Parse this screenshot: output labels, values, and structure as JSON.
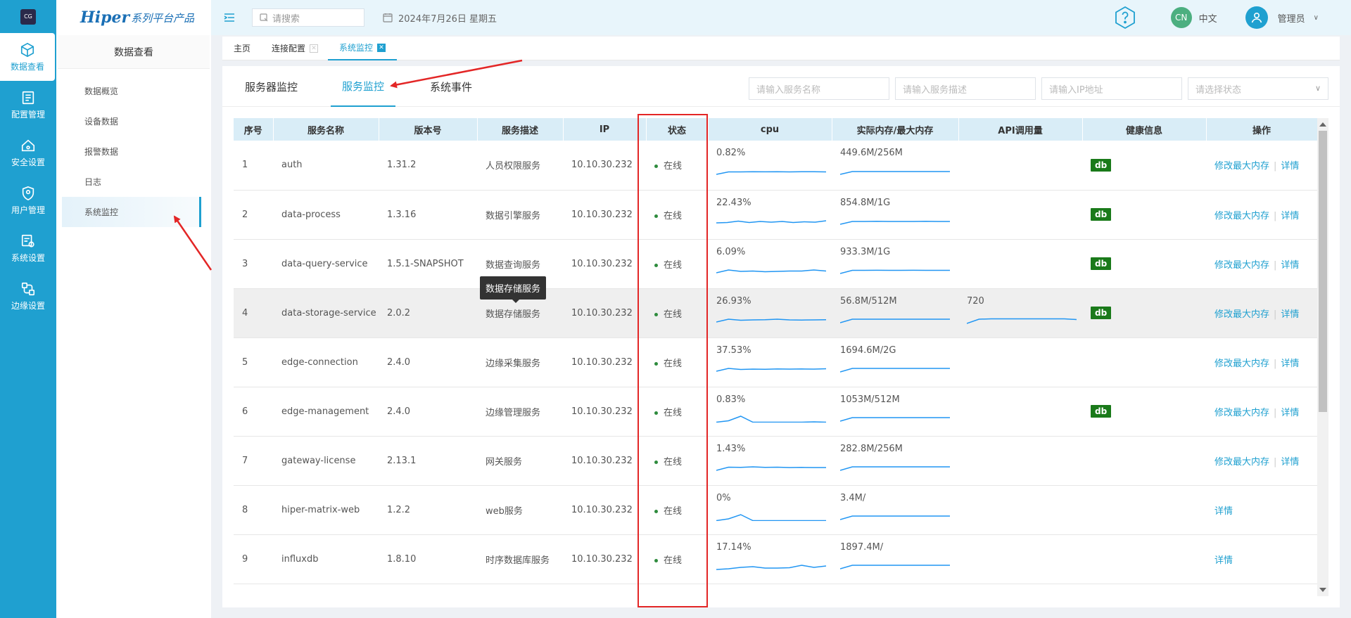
{
  "rail": {
    "logo_text": "CG",
    "items": [
      {
        "label": "数据查看",
        "icon": "cube-icon",
        "active": true
      },
      {
        "label": "配置管理",
        "icon": "config-icon",
        "active": false
      },
      {
        "label": "安全设置",
        "icon": "security-icon",
        "active": false
      },
      {
        "label": "用户管理",
        "icon": "user-shield-icon",
        "active": false
      },
      {
        "label": "系统设置",
        "icon": "system-settings-icon",
        "active": false
      },
      {
        "label": "边缘设置",
        "icon": "edge-icon",
        "active": false
      }
    ]
  },
  "brand": {
    "main": "Hiper",
    "sub": "系列平台产品"
  },
  "sidebar": {
    "title": "数据查看",
    "items": [
      {
        "label": "数据概览",
        "active": false
      },
      {
        "label": "设备数据",
        "active": false
      },
      {
        "label": "报警数据",
        "active": false
      },
      {
        "label": "日志",
        "active": false
      },
      {
        "label": "系统监控",
        "active": true
      }
    ]
  },
  "topbar": {
    "search_placeholder": "请搜索",
    "date": "2024年7月26日 星期五",
    "lang_avatar": "CN",
    "lang_label": "中文",
    "user_label": "管理员"
  },
  "page_tabs": [
    {
      "label": "主页",
      "closable": false,
      "active": false
    },
    {
      "label": "连接配置",
      "closable": true,
      "active": false
    },
    {
      "label": "系统监控",
      "closable": true,
      "active": true
    }
  ],
  "sub_tabs": [
    {
      "label": "服务器监控",
      "active": false
    },
    {
      "label": "服务监控",
      "active": true
    },
    {
      "label": "系统事件",
      "active": false
    }
  ],
  "filters": {
    "service_name": "请输入服务名称",
    "service_desc": "请输入服务描述",
    "ip": "请输入IP地址",
    "status": "请选择状态"
  },
  "table": {
    "headers": [
      "序号",
      "服务名称",
      "版本号",
      "服务描述",
      "IP",
      "状态",
      "cpu",
      "实际内存/最大内存",
      "API调用量",
      "健康信息",
      "操作"
    ],
    "rows": [
      {
        "idx": "1",
        "name": "auth",
        "version": "1.31.2",
        "desc": "人员权限服务",
        "ip": "10.10.30.232",
        "status": "在线",
        "cpu": "0.82%",
        "mem": "449.6M/256M",
        "api": "",
        "health": "db",
        "ops": [
          "修改最大内存",
          "详情"
        ],
        "cpu_series": [
          0.2,
          0.55,
          0.55,
          0.58,
          0.56,
          0.58,
          0.55,
          0.58,
          0.57,
          0.55
        ],
        "mem_series": [
          0.2,
          0.6,
          0.6,
          0.6,
          0.6,
          0.6,
          0.6,
          0.6,
          0.6,
          0.6
        ],
        "api_series": []
      },
      {
        "idx": "2",
        "name": "data-process",
        "version": "1.3.16",
        "desc": "数据引擎服务",
        "ip": "10.10.30.232",
        "status": "在线",
        "cpu": "22.43%",
        "mem": "854.8M/1G",
        "api": "",
        "health": "db",
        "ops": [
          "修改最大内存",
          "详情"
        ],
        "cpu_series": [
          0.4,
          0.45,
          0.65,
          0.45,
          0.6,
          0.5,
          0.6,
          0.45,
          0.55,
          0.5,
          0.7
        ],
        "mem_series": [
          0.2,
          0.6,
          0.6,
          0.62,
          0.6,
          0.6,
          0.6,
          0.62,
          0.6,
          0.6
        ],
        "api_series": []
      },
      {
        "idx": "3",
        "name": "data-query-service",
        "version": "1.5.1-SNAPSHOT",
        "desc": "数据查询服务",
        "ip": "10.10.30.232",
        "status": "在线",
        "cpu": "6.09%",
        "mem": "933.3M/1G",
        "api": "",
        "health": "db",
        "ops": [
          "修改最大内存",
          "详情"
        ],
        "cpu_series": [
          0.3,
          0.7,
          0.5,
          0.55,
          0.45,
          0.5,
          0.55,
          0.55,
          0.7,
          0.55
        ],
        "mem_series": [
          0.2,
          0.65,
          0.65,
          0.66,
          0.65,
          0.65,
          0.66,
          0.65,
          0.65,
          0.65
        ],
        "api_series": []
      },
      {
        "idx": "4",
        "name": "data-storage-service",
        "version": "2.0.2",
        "desc": "数据存储服务",
        "ip": "10.10.30.232",
        "status": "在线",
        "cpu": "26.93%",
        "mem": "56.8M/512M",
        "api": "720",
        "health": "db",
        "ops": [
          "修改最大内存",
          "详情"
        ],
        "cpu_series": [
          0.3,
          0.7,
          0.55,
          0.6,
          0.62,
          0.7,
          0.6,
          0.58,
          0.6,
          0.62
        ],
        "mem_series": [
          0.2,
          0.7,
          0.7,
          0.7,
          0.7,
          0.7,
          0.7,
          0.7,
          0.7,
          0.7
        ],
        "api_series": [
          0.1,
          0.7,
          0.75,
          0.75,
          0.75,
          0.75,
          0.75,
          0.75,
          0.75,
          0.65
        ],
        "hover": true
      },
      {
        "idx": "5",
        "name": "edge-connection",
        "version": "2.4.0",
        "desc": "边缘采集服务",
        "ip": "10.10.30.232",
        "status": "在线",
        "cpu": "37.53%",
        "mem": "1694.6M/2G",
        "api": "",
        "health": "",
        "ops": [
          "修改最大内存",
          "详情"
        ],
        "cpu_series": [
          0.3,
          0.7,
          0.55,
          0.6,
          0.58,
          0.62,
          0.6,
          0.62,
          0.6,
          0.65
        ],
        "mem_series": [
          0.2,
          0.7,
          0.7,
          0.7,
          0.7,
          0.7,
          0.7,
          0.7,
          0.7,
          0.7
        ],
        "api_series": []
      },
      {
        "idx": "6",
        "name": "edge-management",
        "version": "2.4.0",
        "desc": "边缘管理服务",
        "ip": "10.10.30.232",
        "status": "在线",
        "cpu": "0.83%",
        "mem": "1053M/512M",
        "api": "",
        "health": "db",
        "ops": [
          "修改最大内存",
          "详情"
        ],
        "cpu_series": [
          0.05,
          0.25,
          0.9,
          0.05,
          0.05,
          0.05,
          0.05,
          0.05,
          0.1,
          0.05
        ],
        "mem_series": [
          0.2,
          0.7,
          0.7,
          0.7,
          0.7,
          0.7,
          0.7,
          0.7,
          0.7,
          0.7
        ],
        "api_series": []
      },
      {
        "idx": "7",
        "name": "gateway-license",
        "version": "2.13.1",
        "desc": "网关服务",
        "ip": "10.10.30.232",
        "status": "在线",
        "cpu": "1.43%",
        "mem": "282.8M/256M",
        "api": "",
        "health": "",
        "ops": [
          "修改最大内存",
          "详情"
        ],
        "cpu_series": [
          0.2,
          0.65,
          0.62,
          0.7,
          0.62,
          0.65,
          0.6,
          0.62,
          0.6,
          0.6
        ],
        "mem_series": [
          0.2,
          0.7,
          0.7,
          0.7,
          0.7,
          0.7,
          0.7,
          0.7,
          0.7,
          0.7
        ],
        "api_series": []
      },
      {
        "idx": "8",
        "name": "hiper-matrix-web",
        "version": "1.2.2",
        "desc": "web服务",
        "ip": "10.10.30.232",
        "status": "在线",
        "cpu": "0%",
        "mem": "3.4M/",
        "api": "",
        "health": "",
        "ops": [
          "详情"
        ],
        "cpu_series": [
          0.05,
          0.3,
          0.9,
          0.05,
          0.05,
          0.05,
          0.05,
          0.05,
          0.05,
          0.05
        ],
        "mem_series": [
          0.2,
          0.7,
          0.7,
          0.7,
          0.7,
          0.7,
          0.7,
          0.7,
          0.7,
          0.7
        ],
        "api_series": []
      },
      {
        "idx": "9",
        "name": "influxdb",
        "version": "1.8.10",
        "desc": "时序数据库服务",
        "ip": "10.10.30.232",
        "status": "在线",
        "cpu": "17.14%",
        "mem": "1897.4M/",
        "api": "",
        "health": "",
        "ops": [
          "详情"
        ],
        "cpu_series": [
          0.1,
          0.2,
          0.4,
          0.5,
          0.3,
          0.3,
          0.35,
          0.7,
          0.4,
          0.6
        ],
        "mem_series": [
          0.2,
          0.7,
          0.7,
          0.7,
          0.7,
          0.7,
          0.7,
          0.7,
          0.7,
          0.7
        ],
        "api_series": []
      }
    ]
  },
  "tooltip": "数据存储服务",
  "colors": {
    "accent": "#1fa0d0",
    "status_online": "#2e8b3d",
    "health_db": "#1a7a1a",
    "annotation": "#e32626",
    "sparkline": "#2196f3"
  }
}
